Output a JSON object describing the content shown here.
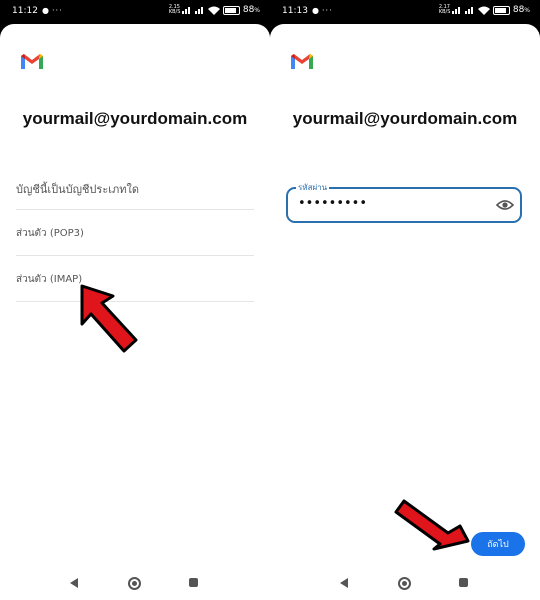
{
  "left": {
    "status": {
      "time": "11:12",
      "speed_value": "2.15",
      "speed_unit": "KB/S",
      "battery": "88",
      "battery_unit": "%"
    },
    "account_email": "yourmail@yourdomain.com",
    "prompt": "บัญชีนี้เป็นบัญชีประเภทใด",
    "options": [
      "ส่วนตัว (POP3)",
      "ส่วนตัว (IMAP)"
    ]
  },
  "right": {
    "status": {
      "time": "11:13",
      "speed_value": "2.17",
      "speed_unit": "KB/S",
      "battery": "88",
      "battery_unit": "%"
    },
    "account_email": "yourmail@yourdomain.com",
    "password": {
      "label": "รหัสผ่าน",
      "masked_value": "•••••••••"
    },
    "next_label": "ถัดไป"
  },
  "colors": {
    "accent": "#1a73e8",
    "focus": "#2a6fae",
    "arrow_fill": "#e0141b",
    "arrow_outline": "#000000"
  },
  "icons": [
    "gmail-logo-icon",
    "eye-icon",
    "back-icon",
    "home-icon",
    "recents-icon",
    "wifi-icon",
    "signal-icon",
    "battery-icon",
    "chat-icon"
  ]
}
